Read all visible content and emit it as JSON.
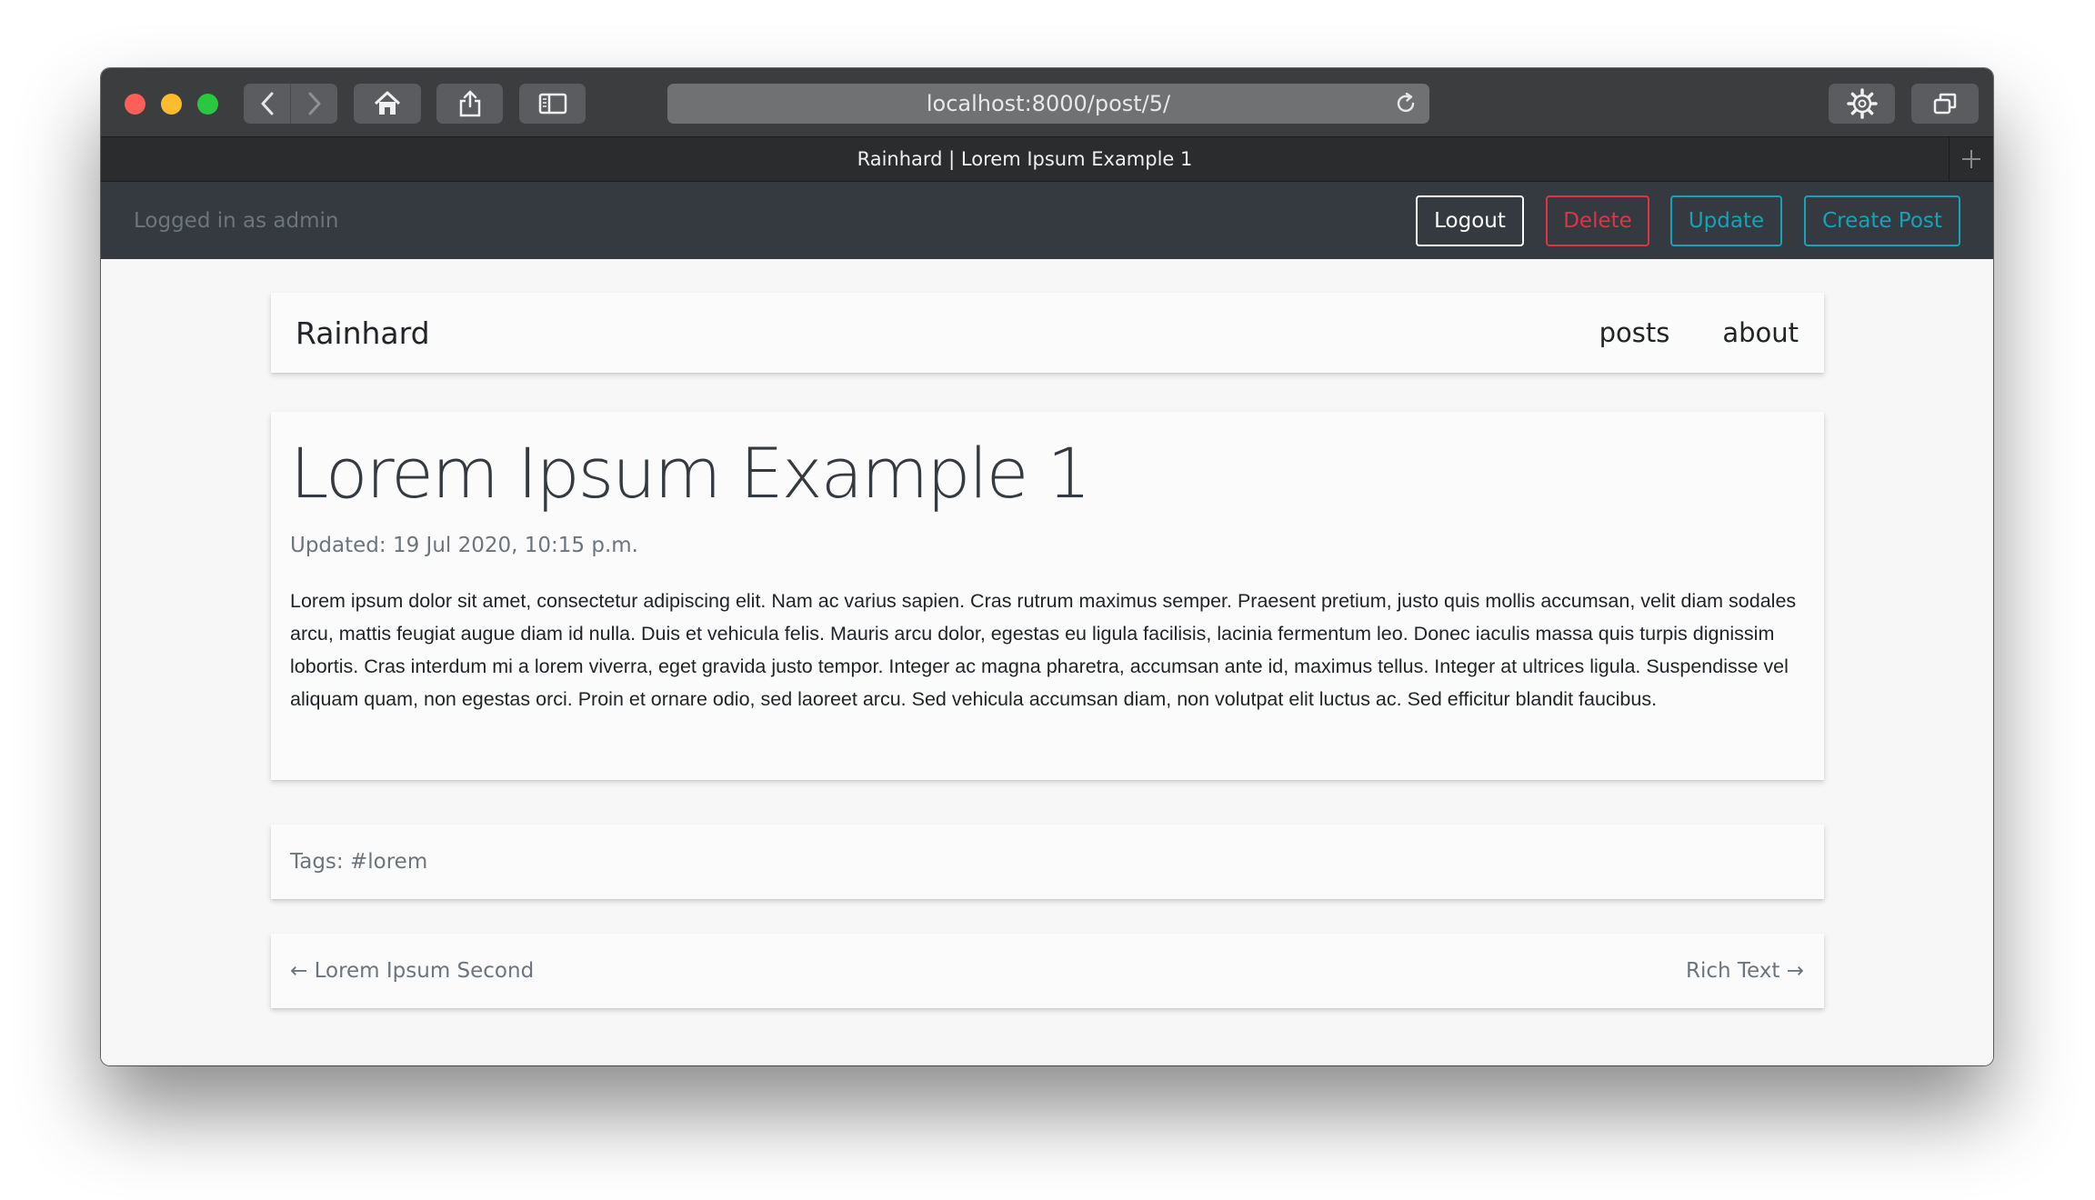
{
  "browser": {
    "url": "localhost:8000/post/5/",
    "tab_title": "Rainhard | Lorem Ipsum Example 1",
    "icons": [
      "back-icon",
      "forward-icon",
      "home-icon",
      "share-icon",
      "sidebar-icon",
      "reload-icon",
      "gear-icon",
      "tabs-icon",
      "plus-icon"
    ]
  },
  "admin": {
    "logged_in_text": "Logged in as admin",
    "logout_label": "Logout",
    "delete_label": "Delete",
    "update_label": "Update",
    "create_label": "Create Post",
    "colors": {
      "danger": "#dc3545",
      "info": "#17a2b8",
      "bar": "#343a40"
    }
  },
  "nav": {
    "brand": "Rainhard",
    "links": [
      "posts",
      "about"
    ]
  },
  "post": {
    "title": "Lorem Ipsum Example 1",
    "updated": "Updated: 19 Jul 2020, 10:15 p.m.",
    "body": "Lorem ipsum dolor sit amet, consectetur adipiscing elit. Nam ac varius sapien. Cras rutrum maximus semper. Praesent pretium, justo quis mollis accumsan, velit diam sodales arcu, mattis feugiat augue diam id nulla. Duis et vehicula felis. Mauris arcu dolor, egestas eu ligula facilisis, lacinia fermentum leo. Donec iaculis massa quis turpis dignissim lobortis. Cras interdum mi a lorem viverra, eget gravida justo tempor. Integer ac magna pharetra, accumsan ante id, maximus tellus. Integer at ultrices ligula. Suspendisse vel aliquam quam, non egestas orci. Proin et ornare odio, sed laoreet arcu. Sed vehicula accumsan diam, non volutpat elit luctus ac. Sed efficitur blandit faucibus.",
    "tags": "Tags: #lorem"
  },
  "pagination": {
    "prev": "← Lorem Ipsum Second",
    "next": "Rich Text →"
  }
}
